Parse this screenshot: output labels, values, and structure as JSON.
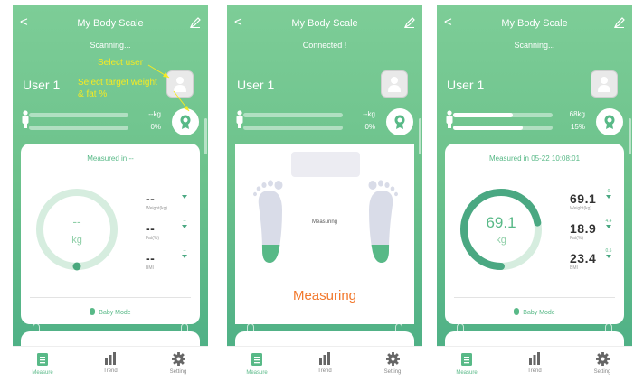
{
  "common": {
    "title": "My Body Scale",
    "back_glyph": "<",
    "user_name": "User 1",
    "nav": [
      {
        "label": "Measure",
        "icon": "measure-icon"
      },
      {
        "label": "Trend",
        "icon": "trend-icon"
      },
      {
        "label": "Setting",
        "icon": "gear-icon"
      }
    ],
    "baby_mode": "Baby Mode",
    "colors": {
      "accent": "#58b987",
      "gradient_top": "#7dcd97",
      "gradient_bottom": "#49ad85",
      "measuring": "#f2782c",
      "annotation": "#f5ea23"
    }
  },
  "screens": [
    {
      "status": "Scanning...",
      "weight_value": "--kg",
      "fat_value": "0%",
      "weight_bar_fill": 0,
      "fat_bar_fill": 0,
      "measured_text": "Measured in --",
      "big_value": "--",
      "big_unit": "kg",
      "ring_fill": 0,
      "metrics": [
        {
          "value": "--",
          "label": "Weight(kg)",
          "target": "--"
        },
        {
          "value": "--",
          "label": "Fat(%)",
          "target": "--"
        },
        {
          "value": "--",
          "label": "BMI",
          "target": "--"
        }
      ],
      "annotations": {
        "select_user": "Select user",
        "select_target_line1": "Select target weight",
        "select_target_line2": "& fat %"
      }
    },
    {
      "status": "Connected !",
      "weight_value": "--kg",
      "fat_value": "0%",
      "weight_bar_fill": 0,
      "fat_bar_fill": 0,
      "measuring_small": "Measuring",
      "measuring_big": "Measuring"
    },
    {
      "status": "Scanning...",
      "weight_value": "68kg",
      "fat_value": "15%",
      "weight_bar_fill": 0.6,
      "fat_bar_fill": 0.7,
      "measured_text": "Measured in 05-22 10:08:01",
      "big_value": "69.1",
      "big_unit": "kg",
      "ring_fill": 0.72,
      "metrics": [
        {
          "value": "69.1",
          "label": "Weight(kg)",
          "target": "0"
        },
        {
          "value": "18.9",
          "label": "Fat(%)",
          "target": "4.4"
        },
        {
          "value": "23.4",
          "label": "BMI",
          "target": "0.5"
        }
      ]
    }
  ]
}
